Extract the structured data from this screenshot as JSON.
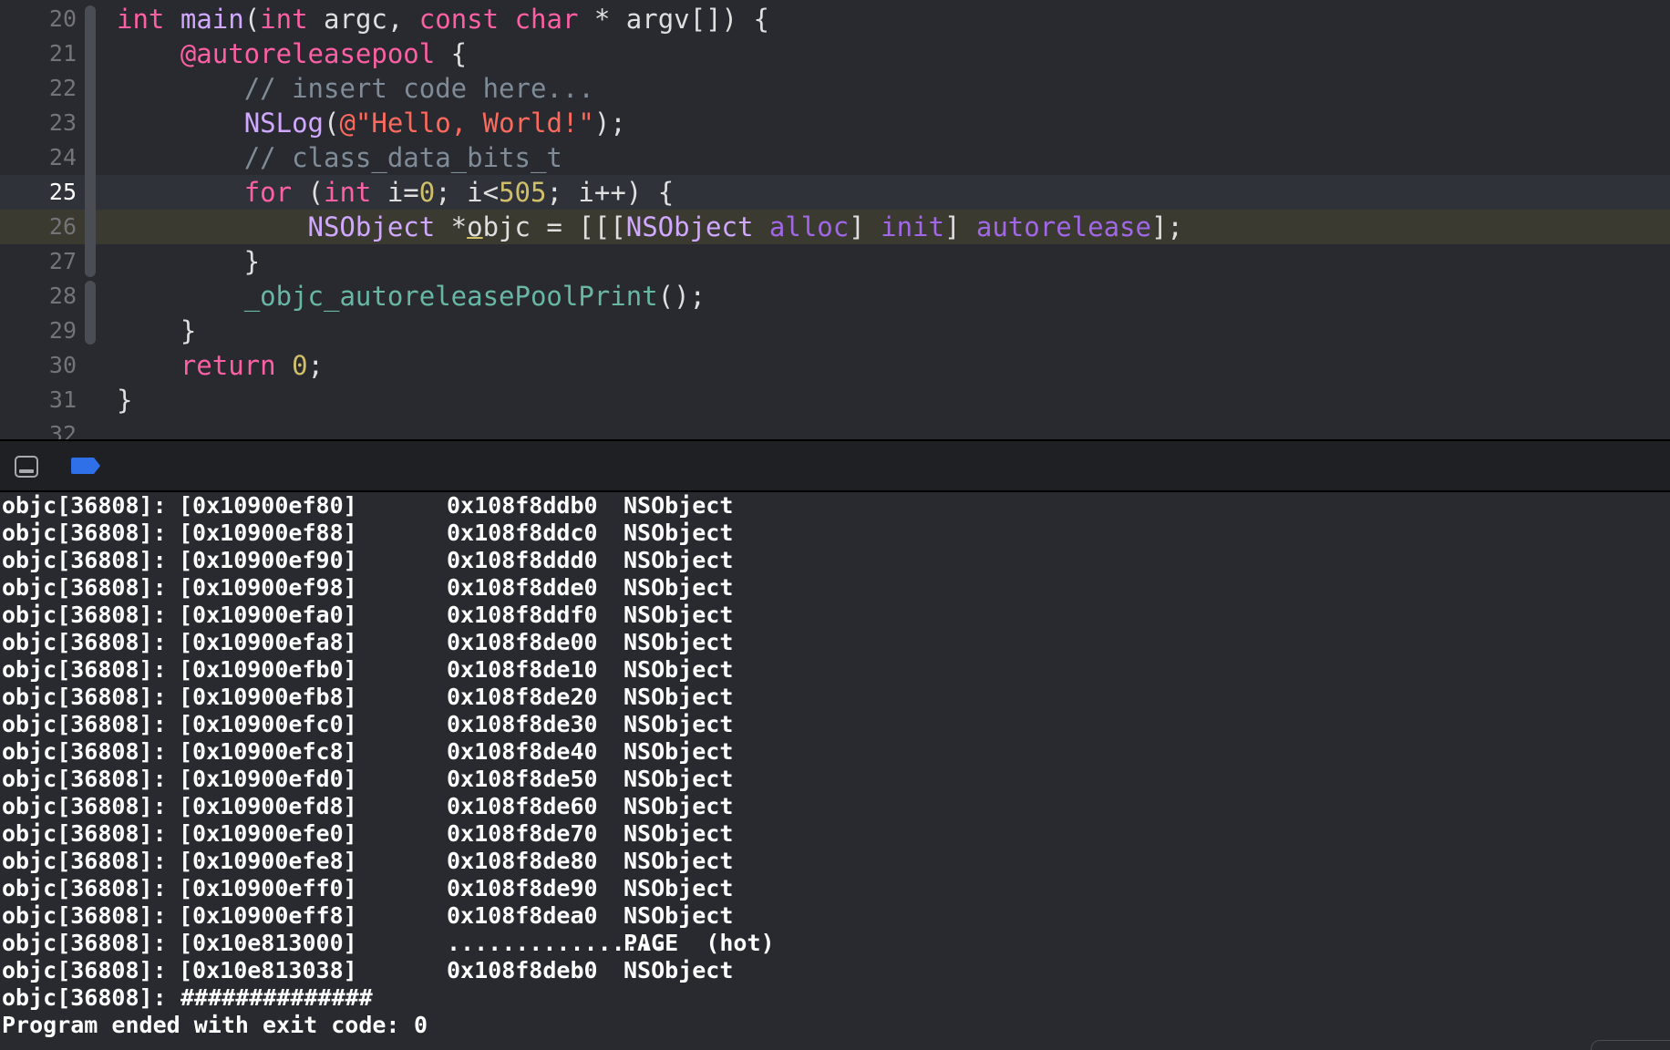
{
  "editor": {
    "lines": [
      {
        "num": "20",
        "tokens": [
          {
            "t": "int",
            "c": "kw"
          },
          {
            "t": " ",
            "c": "pl"
          },
          {
            "t": "main",
            "c": "ty"
          },
          {
            "t": "(",
            "c": "pl"
          },
          {
            "t": "int",
            "c": "kw"
          },
          {
            "t": " argc, ",
            "c": "pl"
          },
          {
            "t": "const",
            "c": "kw"
          },
          {
            "t": " ",
            "c": "pl"
          },
          {
            "t": "char",
            "c": "kw"
          },
          {
            "t": " * argv[]) {",
            "c": "pl"
          }
        ]
      },
      {
        "num": "21",
        "tokens": [
          {
            "t": "    ",
            "c": "pl"
          },
          {
            "t": "@autoreleasepool",
            "c": "kw"
          },
          {
            "t": " {",
            "c": "pl"
          }
        ]
      },
      {
        "num": "22",
        "tokens": [
          {
            "t": "        ",
            "c": "pl"
          },
          {
            "t": "// insert code here...",
            "c": "cm"
          }
        ]
      },
      {
        "num": "23",
        "tokens": [
          {
            "t": "        ",
            "c": "pl"
          },
          {
            "t": "NSLog",
            "c": "ty"
          },
          {
            "t": "(",
            "c": "pl"
          },
          {
            "t": "@\"Hello, World!\"",
            "c": "str"
          },
          {
            "t": ");",
            "c": "pl"
          }
        ]
      },
      {
        "num": "24",
        "tokens": [
          {
            "t": "        ",
            "c": "pl"
          },
          {
            "t": "// class_data_bits_t",
            "c": "cm"
          }
        ]
      },
      {
        "num": "25",
        "state": "cursor",
        "tokens": [
          {
            "t": "        ",
            "c": "pl"
          },
          {
            "t": "for",
            "c": "kw"
          },
          {
            "t": " (",
            "c": "pl"
          },
          {
            "t": "int",
            "c": "kw"
          },
          {
            "t": " i=",
            "c": "pl"
          },
          {
            "t": "0",
            "c": "num"
          },
          {
            "t": "; i<",
            "c": "pl"
          },
          {
            "t": "505",
            "c": "num"
          },
          {
            "t": "; i++) {",
            "c": "pl"
          }
        ]
      },
      {
        "num": "26",
        "state": "exec",
        "tokens": [
          {
            "t": "            ",
            "c": "pl"
          },
          {
            "t": "NSObject",
            "c": "ty"
          },
          {
            "t": " *",
            "c": "pl"
          },
          {
            "t": "o",
            "c": "pl ul"
          },
          {
            "t": "bjc = [[[",
            "c": "pl"
          },
          {
            "t": "NSObject",
            "c": "ty"
          },
          {
            "t": " ",
            "c": "pl"
          },
          {
            "t": "alloc",
            "c": "fn"
          },
          {
            "t": "] ",
            "c": "pl"
          },
          {
            "t": "init",
            "c": "fn"
          },
          {
            "t": "] ",
            "c": "pl"
          },
          {
            "t": "autorelease",
            "c": "fn"
          },
          {
            "t": "];",
            "c": "pl"
          }
        ]
      },
      {
        "num": "27",
        "tokens": [
          {
            "t": "        }",
            "c": "pl"
          }
        ]
      },
      {
        "num": "28",
        "tokens": [
          {
            "t": "        ",
            "c": "pl"
          },
          {
            "t": "_objc_autoreleasePoolPrint",
            "c": "lib"
          },
          {
            "t": "();",
            "c": "pl"
          }
        ]
      },
      {
        "num": "29",
        "tokens": [
          {
            "t": "    }",
            "c": "pl"
          }
        ]
      },
      {
        "num": "30",
        "tokens": [
          {
            "t": "    ",
            "c": "pl"
          },
          {
            "t": "return",
            "c": "kw"
          },
          {
            "t": " ",
            "c": "pl"
          },
          {
            "t": "0",
            "c": "num"
          },
          {
            "t": ";",
            "c": "pl"
          }
        ]
      },
      {
        "num": "31",
        "tokens": [
          {
            "t": "}",
            "c": "pl"
          }
        ]
      },
      {
        "num": "32",
        "tokens": []
      }
    ]
  },
  "debug_bar": {
    "hide_icon": "hide-debug-area-icon",
    "breakpoint_icon": "breakpoints-toggle-icon",
    "accent": "#2f6fe8"
  },
  "console": {
    "rows": [
      {
        "prefix": "objc[36808]:",
        "addr": "[0x10900ef80]",
        "obj": "0x108f8ddb0",
        "name": "NSObject"
      },
      {
        "prefix": "objc[36808]:",
        "addr": "[0x10900ef88]",
        "obj": "0x108f8ddc0",
        "name": "NSObject"
      },
      {
        "prefix": "objc[36808]:",
        "addr": "[0x10900ef90]",
        "obj": "0x108f8ddd0",
        "name": "NSObject"
      },
      {
        "prefix": "objc[36808]:",
        "addr": "[0x10900ef98]",
        "obj": "0x108f8dde0",
        "name": "NSObject"
      },
      {
        "prefix": "objc[36808]:",
        "addr": "[0x10900efa0]",
        "obj": "0x108f8ddf0",
        "name": "NSObject"
      },
      {
        "prefix": "objc[36808]:",
        "addr": "[0x10900efa8]",
        "obj": "0x108f8de00",
        "name": "NSObject"
      },
      {
        "prefix": "objc[36808]:",
        "addr": "[0x10900efb0]",
        "obj": "0x108f8de10",
        "name": "NSObject"
      },
      {
        "prefix": "objc[36808]:",
        "addr": "[0x10900efb8]",
        "obj": "0x108f8de20",
        "name": "NSObject"
      },
      {
        "prefix": "objc[36808]:",
        "addr": "[0x10900efc0]",
        "obj": "0x108f8de30",
        "name": "NSObject"
      },
      {
        "prefix": "objc[36808]:",
        "addr": "[0x10900efc8]",
        "obj": "0x108f8de40",
        "name": "NSObject"
      },
      {
        "prefix": "objc[36808]:",
        "addr": "[0x10900efd0]",
        "obj": "0x108f8de50",
        "name": "NSObject"
      },
      {
        "prefix": "objc[36808]:",
        "addr": "[0x10900efd8]",
        "obj": "0x108f8de60",
        "name": "NSObject"
      },
      {
        "prefix": "objc[36808]:",
        "addr": "[0x10900efe0]",
        "obj": "0x108f8de70",
        "name": "NSObject"
      },
      {
        "prefix": "objc[36808]:",
        "addr": "[0x10900efe8]",
        "obj": "0x108f8de80",
        "name": "NSObject"
      },
      {
        "prefix": "objc[36808]:",
        "addr": "[0x10900eff0]",
        "obj": "0x108f8de90",
        "name": "NSObject"
      },
      {
        "prefix": "objc[36808]:",
        "addr": "[0x10900eff8]",
        "obj": "0x108f8dea0",
        "name": "NSObject"
      },
      {
        "prefix": "objc[36808]:",
        "addr": "[0x10e813000]",
        "obj": "................",
        "name": "PAGE  (hot)"
      },
      {
        "prefix": "objc[36808]:",
        "addr": "[0x10e813038]",
        "obj": "0x108f8deb0",
        "name": "NSObject"
      }
    ],
    "trailer": [
      {
        "prefix": "objc[36808]:",
        "tail": "##############"
      },
      {
        "prefix": "Program ended with exit code:",
        "tail": "0"
      }
    ]
  }
}
